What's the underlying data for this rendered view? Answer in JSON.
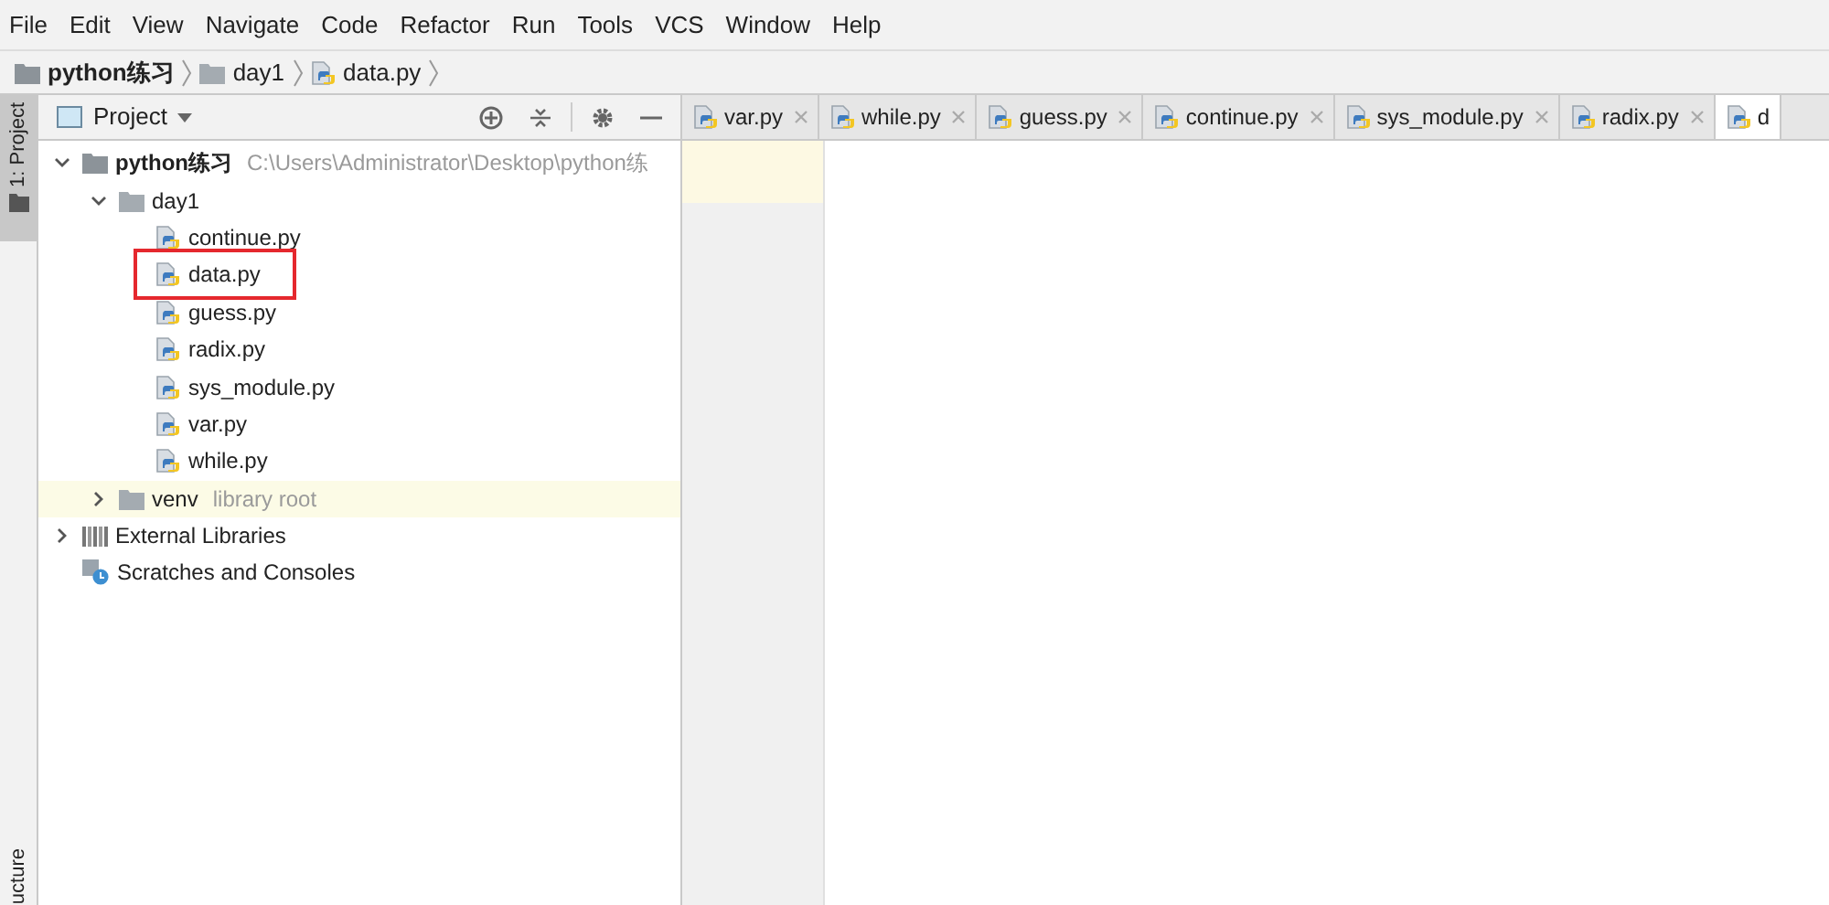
{
  "menu": [
    "File",
    "Edit",
    "View",
    "Navigate",
    "Code",
    "Refactor",
    "Run",
    "Tools",
    "VCS",
    "Window",
    "Help"
  ],
  "breadcrumb": [
    {
      "label": "python练习",
      "kind": "project"
    },
    {
      "label": "day1",
      "kind": "folder"
    },
    {
      "label": "data.py",
      "kind": "file"
    }
  ],
  "side_strip": {
    "top": "1: Project",
    "bottom": "ucture"
  },
  "project_panel": {
    "title": "Project"
  },
  "tree": [
    {
      "label": "python练习",
      "kind": "project",
      "note": "C:\\Users\\Administrator\\Desktop\\python练",
      "expanded": true,
      "highlighted": false,
      "children": [
        {
          "label": "day1",
          "kind": "folder",
          "expanded": true,
          "highlighted": false,
          "children": [
            {
              "label": "continue.py",
              "kind": "file",
              "marked": false
            },
            {
              "label": "data.py",
              "kind": "file",
              "marked": true
            },
            {
              "label": "guess.py",
              "kind": "file",
              "marked": false
            },
            {
              "label": "radix.py",
              "kind": "file",
              "marked": false
            },
            {
              "label": "sys_module.py",
              "kind": "file",
              "marked": false
            },
            {
              "label": "var.py",
              "kind": "file",
              "marked": false
            },
            {
              "label": "while.py",
              "kind": "file",
              "marked": false
            }
          ]
        },
        {
          "label": "venv",
          "kind": "folder",
          "note": "library root",
          "expanded": false,
          "highlighted": true
        }
      ]
    },
    {
      "label": "External Libraries",
      "kind": "libraries",
      "expanded": false
    },
    {
      "label": "Scratches and Consoles",
      "kind": "scratches"
    }
  ],
  "tabs": [
    {
      "label": "var.py",
      "selected": false
    },
    {
      "label": "while.py",
      "selected": false
    },
    {
      "label": "guess.py",
      "selected": false
    },
    {
      "label": "continue.py",
      "selected": false
    },
    {
      "label": "sys_module.py",
      "selected": false
    },
    {
      "label": "radix.py",
      "selected": false
    },
    {
      "label": "d",
      "selected": true
    }
  ]
}
